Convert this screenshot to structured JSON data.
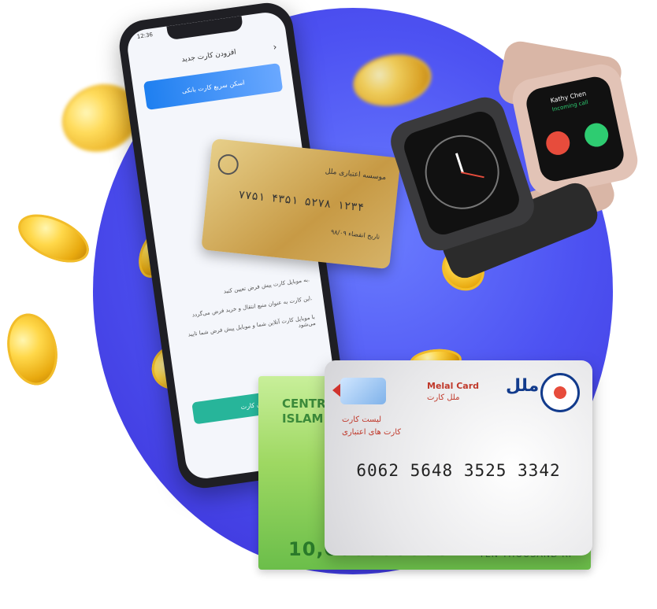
{
  "phone": {
    "status_time": "12:36",
    "screen_title": "افزودن کارت جدید",
    "scan_button": "اسکن سریع کارت بانکی",
    "info_line_1": "به موبایل کارت پیش فرض تعیین کنید.",
    "info_line_2": "این کارت به عنوان منبع انتقال و خرید فرض می‌گردد.",
    "info_line_3": "با موبایل کارت آنلاین شما و موبایل پیش فرض شما تایید می‌شود",
    "confirm_button": "افزودن کارت",
    "accent": "#27b59a"
  },
  "gold_card": {
    "issuer": "موسسه اعتباری ملل",
    "number": "۷۷۵۱ ۴۳۵۱ ۵۲۷۸ ۱۲۳۴",
    "expiry_label": "تاریخ انقضاء ۹۸/۰۹"
  },
  "watch": {
    "caller": "Kathy Chen",
    "status": "Incoming call",
    "decline_color": "#e74c3c",
    "accept_color": "#2ecc71"
  },
  "banknote": {
    "line1": "CENTR",
    "line2": "ISLAM",
    "amount": "10,000000000",
    "words": "TEN THOUSAND RI"
  },
  "bank_card": {
    "brand_en": "Melal Card",
    "brand_fa": "ملل کارت",
    "tag_1": "لیست کارت",
    "tag_2": "کارت های اعتباری",
    "logo_text": "ملل",
    "number": "6062 5648 3525 3342"
  },
  "colors": {
    "background_circle": "#4d52f2",
    "coin": "#ffd84a",
    "card_red": "#c0392b",
    "melal_blue": "#123b8c"
  }
}
